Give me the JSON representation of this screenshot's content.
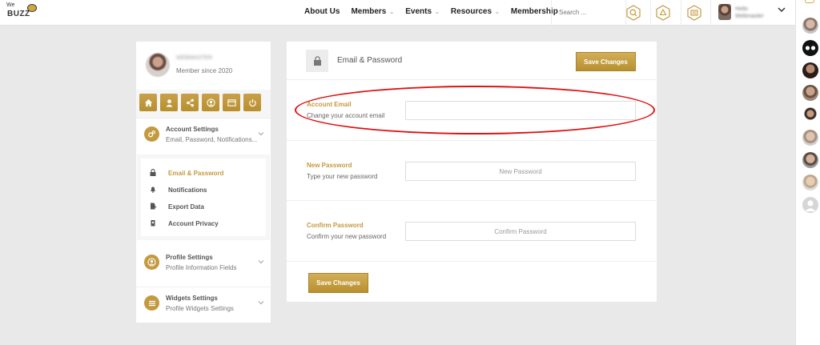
{
  "logo": {
    "line1": "We",
    "line2": "BUZZ"
  },
  "nav": {
    "items": [
      {
        "label": "About Us",
        "has_menu": false
      },
      {
        "label": "Members",
        "has_menu": true
      },
      {
        "label": "Events",
        "has_menu": true
      },
      {
        "label": "Resources",
        "has_menu": true
      },
      {
        "label": "Membership",
        "has_menu": true
      }
    ],
    "chevron": "⌄"
  },
  "search": {
    "placeholder": "Search ..."
  },
  "header_icons": [
    "search-hex-icon",
    "alert-hex-icon",
    "message-hex-icon"
  ],
  "user": {
    "name_line1": "Hello",
    "name_line2": "Webmaster"
  },
  "profile": {
    "name": "WEBMASTER",
    "member_since": "Member since 2020",
    "icon_buttons": [
      "home-icon",
      "user-icon",
      "share-icon",
      "profile-icon",
      "card-icon",
      "power-icon"
    ]
  },
  "sections": [
    {
      "title": "Account Settings",
      "subtitle": "Email, Password, Notifications...",
      "icon": "gears-icon"
    },
    {
      "title": "Profile Settings",
      "subtitle": "Profile Information Fields",
      "icon": "user-circle-icon"
    },
    {
      "title": "Widgets Settings",
      "subtitle": "Profile Widgets Settings",
      "icon": "list-icon"
    }
  ],
  "submenu": [
    {
      "label": "Email & Password",
      "icon": "lock-icon",
      "active": true
    },
    {
      "label": "Notifications",
      "icon": "bell-icon",
      "active": false
    },
    {
      "label": "Export Data",
      "icon": "export-icon",
      "active": false
    },
    {
      "label": "Account Privacy",
      "icon": "privacy-icon",
      "active": false
    }
  ],
  "form": {
    "title": "Email & Password",
    "save_label": "Save Changes",
    "fields": [
      {
        "label": "Account Email",
        "description": "Change your account email",
        "placeholder": "",
        "value": ""
      },
      {
        "label": "New Password",
        "description": "Type your new password",
        "placeholder": "New Password",
        "value": ""
      },
      {
        "label": "Confirm Password",
        "description": "Confirm your new password",
        "placeholder": "Confirm Password",
        "value": ""
      }
    ]
  },
  "colors": {
    "accent": "#c49a40",
    "annotation": "#e01010",
    "page_bg": "#e9e9e9"
  }
}
